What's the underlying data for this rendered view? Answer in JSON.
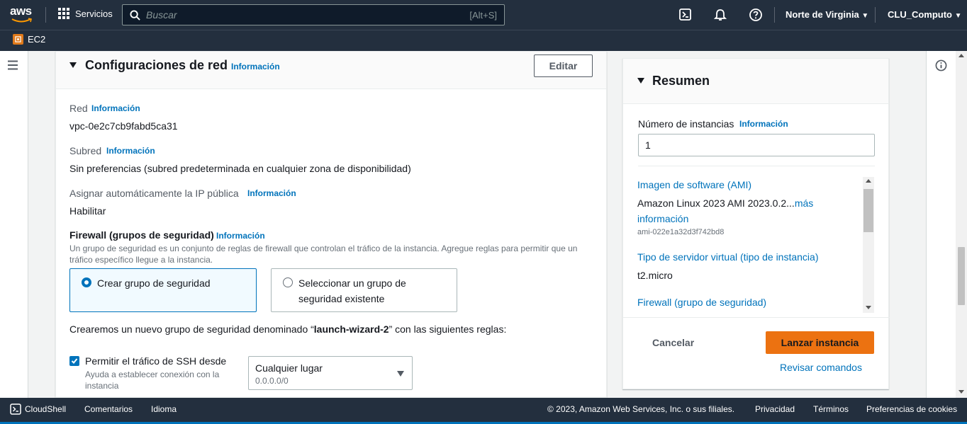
{
  "topbar": {
    "logo_text": "aws",
    "services_label": "Servicios",
    "search_placeholder": "Buscar",
    "search_shortcut": "[Alt+S]",
    "region": "Norte de Virginia",
    "account": "CLU_Computo"
  },
  "subnav": {
    "service": "EC2"
  },
  "network": {
    "title": "Configuraciones de red",
    "title_info": "Información",
    "edit_label": "Editar",
    "vpc_label": "Red",
    "vpc_info": "Información",
    "vpc_value": "vpc-0e2c7cb9fabd5ca31",
    "subnet_label": "Subred",
    "subnet_info": "Información",
    "subnet_value": "Sin preferencias (subred predeterminada en cualquier zona de disponibilidad)",
    "public_ip_label": "Asignar automáticamente la IP pública",
    "public_ip_info": "Información",
    "public_ip_value": "Habilitar",
    "firewall_label": "Firewall (grupos de seguridad)",
    "firewall_info": "Información",
    "firewall_desc_1": "Un grupo de seguridad es un conjunto de reglas de firewall que controlan el tráfico de la instancia. Agregue reglas para permitir que un",
    "firewall_desc_2": "tráfico específico llegue a la instancia.",
    "option_create": "Crear grupo de seguridad",
    "option_select_1": "Seleccionar un grupo de",
    "option_select_2": "seguridad existente",
    "create_note_pre": "Crearemos un nuevo grupo de seguridad denominado “",
    "create_note_name": "launch-wizard-2",
    "create_note_post": "” con las siguientes reglas:",
    "ssh_label": "Permitir el tráfico de SSH desde",
    "ssh_help_1": "Ayuda a establecer conexión con la",
    "ssh_help_2": "instancia",
    "ssh_checked": true,
    "ssh_source": "Cualquier lugar",
    "ssh_source_cidr": "0.0.0.0/0"
  },
  "summary": {
    "title": "Resumen",
    "instances_label": "Número de instancias",
    "instances_info": "Información",
    "instances_value": "1",
    "ami_label": "Imagen de software (AMI)",
    "ami_value": "Amazon Linux 2023 AMI 2023.0.2...",
    "ami_more_1": "más",
    "ami_more_2": "información",
    "ami_id": "ami-022e1a32d3f742bd8",
    "type_label": "Tipo de servidor virtual (tipo de instancia)",
    "type_value": "t2.micro",
    "firewall_label": "Firewall (grupo de seguridad)",
    "cancel_label": "Cancelar",
    "launch_label": "Lanzar instancia",
    "review_label": "Revisar comandos"
  },
  "footer": {
    "cloudshell": "CloudShell",
    "feedback": "Comentarios",
    "language": "Idioma",
    "copyright": "© 2023, Amazon Web Services, Inc. o sus filiales.",
    "privacy": "Privacidad",
    "terms": "Términos",
    "cookies": "Preferencias de cookies"
  },
  "colors": {
    "accent": "#0073bb",
    "launch": "#ec7211",
    "navbar": "#232f3e"
  }
}
